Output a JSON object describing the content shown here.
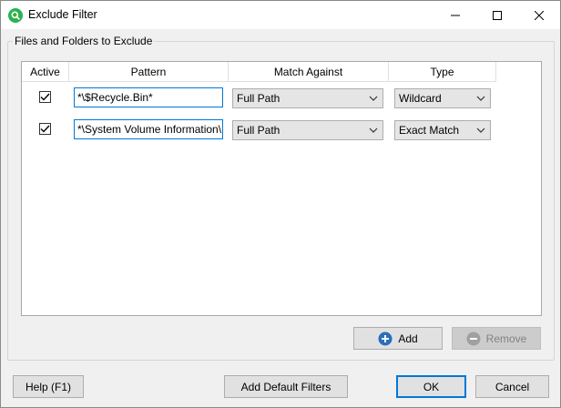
{
  "window": {
    "title": "Exclude Filter",
    "app_icon": "search-icon"
  },
  "group": {
    "label": "Files and Folders to Exclude"
  },
  "table": {
    "headers": {
      "active": "Active",
      "pattern": "Pattern",
      "match": "Match Against",
      "type": "Type"
    },
    "rows": [
      {
        "active": true,
        "pattern": "*\\$Recycle.Bin*",
        "match": "Full Path",
        "type": "Wildcard"
      },
      {
        "active": true,
        "pattern": "*\\System Volume Information\\",
        "match": "Full Path",
        "type": "Exact Match"
      }
    ]
  },
  "buttons": {
    "add": "Add",
    "remove": "Remove",
    "help": "Help (F1)",
    "defaults": "Add Default Filters",
    "ok": "OK",
    "cancel": "Cancel"
  },
  "colors": {
    "accent": "#0078d7",
    "app_icon": "#2bb24c",
    "add_icon": "#2a6ebb",
    "remove_icon": "#a0a0a0"
  }
}
